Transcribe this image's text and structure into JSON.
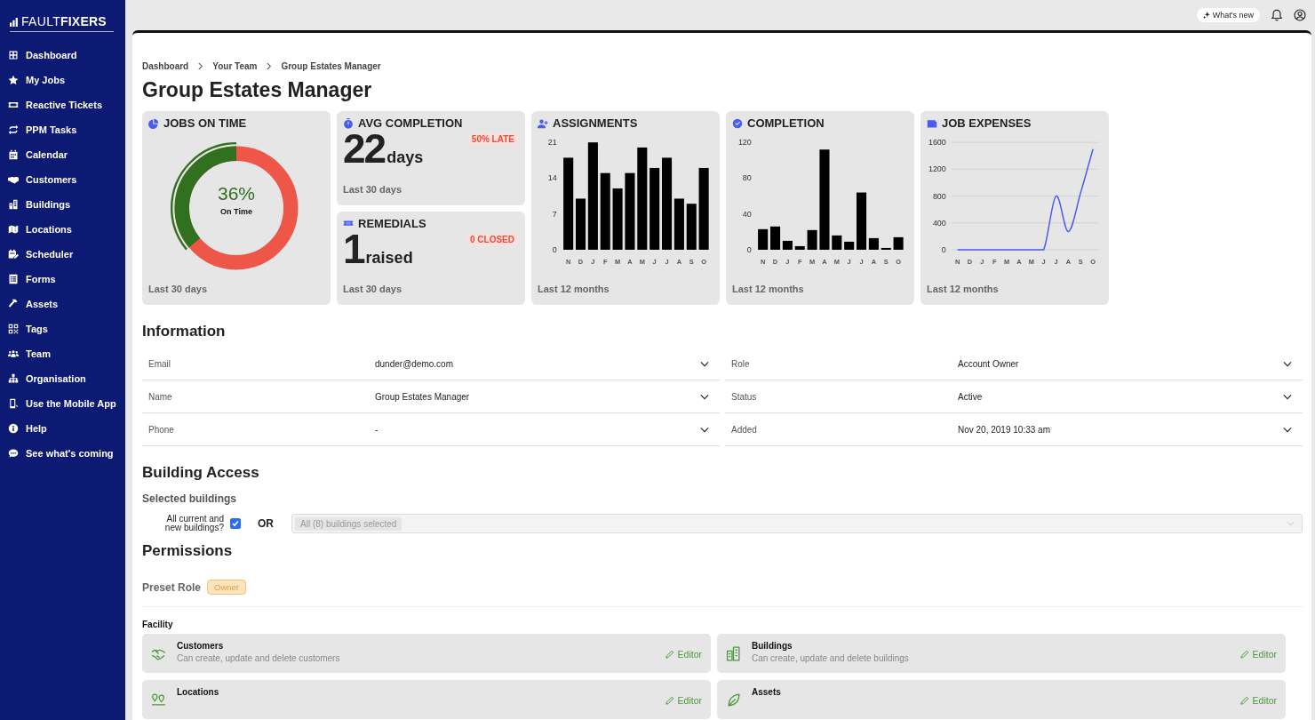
{
  "brand": {
    "light": "FAULT",
    "bold": "FIXERS"
  },
  "sidebar": {
    "items": [
      {
        "label": "Dashboard"
      },
      {
        "label": "My Jobs"
      },
      {
        "label": "Reactive Tickets"
      },
      {
        "label": "PPM Tasks"
      },
      {
        "label": "Calendar"
      },
      {
        "label": "Customers"
      },
      {
        "label": "Buildings"
      },
      {
        "label": "Locations"
      },
      {
        "label": "Scheduler"
      },
      {
        "label": "Forms"
      },
      {
        "label": "Assets"
      },
      {
        "label": "Tags"
      },
      {
        "label": "Team"
      },
      {
        "label": "Organisation"
      },
      {
        "label": "Use the Mobile App"
      },
      {
        "label": "Help"
      },
      {
        "label": "See what's coming"
      }
    ]
  },
  "topbar": {
    "whats_new": "What's new"
  },
  "breadcrumb": [
    "Dashboard",
    "Your Team",
    "Group Estates Manager"
  ],
  "title": "Group Estates Manager",
  "jobs_on_time": {
    "title": "JOBS ON TIME",
    "reading": "36%",
    "caption": "On Time",
    "level": 0.36,
    "footer": "Last 30 days"
  },
  "avg_completion": {
    "title": "AVG COMPLETION",
    "value": "22",
    "unit": "days",
    "badge": "50% LATE",
    "footer": "Last 30 days"
  },
  "remedials": {
    "title": "REMEDIALS",
    "value": "1",
    "unit": "raised",
    "badge": "0 CLOSED",
    "footer": "Last 30 days"
  },
  "charts": [
    {
      "title": "ASSIGNMENTS",
      "footer": "Last 12 months",
      "chart_data": {
        "type": "bar",
        "categories": [
          "N",
          "D",
          "J",
          "F",
          "M",
          "A",
          "M",
          "J",
          "J",
          "A",
          "S",
          "O"
        ],
        "series": [
          {
            "color": "#000000",
            "values": [
              18,
              10,
              21,
              15,
              12,
              15,
              20,
              16,
              18,
              10,
              9,
              16
            ]
          }
        ],
        "yticks": [
          0,
          7,
          14,
          21
        ],
        "ylim": [
          0,
          21
        ]
      }
    },
    {
      "title": "COMPLETION",
      "footer": "Last 12 months",
      "chart_data": {
        "type": "bar",
        "categories": [
          "N",
          "D",
          "J",
          "F",
          "M",
          "A",
          "M",
          "J",
          "J",
          "A",
          "S",
          "O"
        ],
        "series": [
          {
            "color": "#000000",
            "values": [
              23,
              26,
              10,
              4,
              22,
              112,
              16,
              9,
              64,
              13,
              2,
              14
            ]
          }
        ],
        "yticks": [
          0,
          40,
          80,
          120
        ],
        "ylim": [
          0,
          120
        ]
      }
    },
    {
      "title": "JOB EXPENSES",
      "footer": "Last 12 months",
      "chart_data": {
        "type": "line",
        "categories": [
          "N",
          "D",
          "J",
          "F",
          "M",
          "A",
          "M",
          "J",
          "J",
          "A",
          "S",
          "O"
        ],
        "series": [
          {
            "color": "#4a5cf0",
            "values": [
              0,
              0,
              0,
              0,
              0,
              0,
              0,
              0,
              800,
              270,
              850,
              1500
            ]
          }
        ],
        "yticks": [
          0,
          400,
          800,
          1200,
          1600
        ],
        "ylim": [
          0,
          1600
        ],
        "grid": true
      }
    }
  ],
  "information": {
    "title": "Information",
    "fields": [
      {
        "label": "Email",
        "value": "dunder@demo.com"
      },
      {
        "label": "Role",
        "value": "Account Owner"
      },
      {
        "label": "Name",
        "value": "Group Estates Manager"
      },
      {
        "label": "Status",
        "value": "Active"
      },
      {
        "label": "Phone",
        "value": "-"
      },
      {
        "label": "Added",
        "value": "Nov 20, 2019 10:33 am"
      }
    ]
  },
  "building_access": {
    "title": "Building Access",
    "subtitle": "Selected buildings",
    "checkbox_label": "All current and new buildings?",
    "checked": true,
    "or": "OR",
    "select": {
      "chip": "All (8) buildings selected",
      "disabled": true
    }
  },
  "permissions": {
    "title": "Permissions",
    "preset_label": "Preset Role",
    "preset_badge": "Owner",
    "group": "Facility",
    "items": [
      {
        "title": "Customers",
        "description": "Can create, update and delete customers",
        "access": "Editor"
      },
      {
        "title": "Buildings",
        "description": "Can create, update and delete buildings",
        "access": "Editor"
      },
      {
        "title": "Locations",
        "access": "Editor"
      },
      {
        "title": "Assets",
        "access": "Editor"
      }
    ]
  }
}
